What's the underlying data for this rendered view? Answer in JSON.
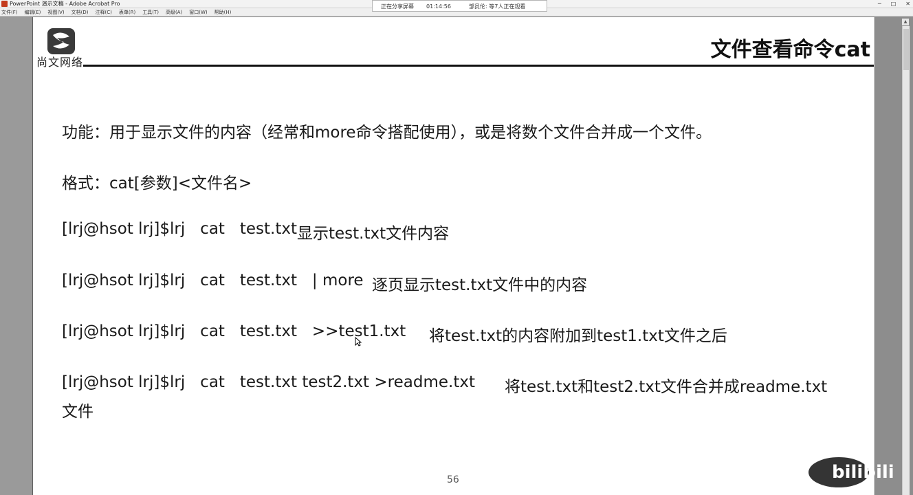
{
  "window": {
    "title": "PowerPoint 演示文稿 - Adobe Acrobat Pro"
  },
  "menu": {
    "items": [
      "文件(F)",
      "编辑(E)",
      "视图(V)",
      "文档(D)",
      "注释(C)",
      "表单(R)",
      "工具(T)",
      "高级(A)",
      "窗口(W)",
      "帮助(H)"
    ]
  },
  "share_banner": {
    "status": "正在分享屏幕",
    "time": "01:14:56",
    "viewers": "邹员伦: 等7人正在观看"
  },
  "slide": {
    "logo_text": "尚文网络",
    "title": "文件查看命令cat",
    "function_line": "功能：用于显示文件的内容（经常和more命令搭配使用），或是将数个文件合并成一个文件。",
    "format_line": "格式：cat[参数]<文件名>",
    "commands": [
      {
        "cmd": "[lrj@hsot lrj]$lrj   cat   test.txt",
        "desc": "显示test.txt文件内容"
      },
      {
        "cmd": "[lrj@hsot lrj]$lrj   cat   test.txt   | more",
        "desc": "逐页显示test.txt文件中的内容"
      },
      {
        "cmd": "[lrj@hsot lrj]$lrj   cat   test.txt   >>test1.txt",
        "desc": "将test.txt的内容附加到test1.txt文件之后"
      },
      {
        "cmd": "[lrj@hsot lrj]$lrj   cat   test.txt test2.txt >readme.txt",
        "desc": "将test.txt和test2.txt文件合并成readme.txt",
        "desc_cont": "文件"
      }
    ],
    "page_number": "56"
  },
  "watermark": {
    "text": "bilibili"
  },
  "colors": {
    "slide_bg": "#ffffff",
    "text": "#1a1a1a",
    "rule": "#111111",
    "window_bg": "#8a8a8a"
  }
}
